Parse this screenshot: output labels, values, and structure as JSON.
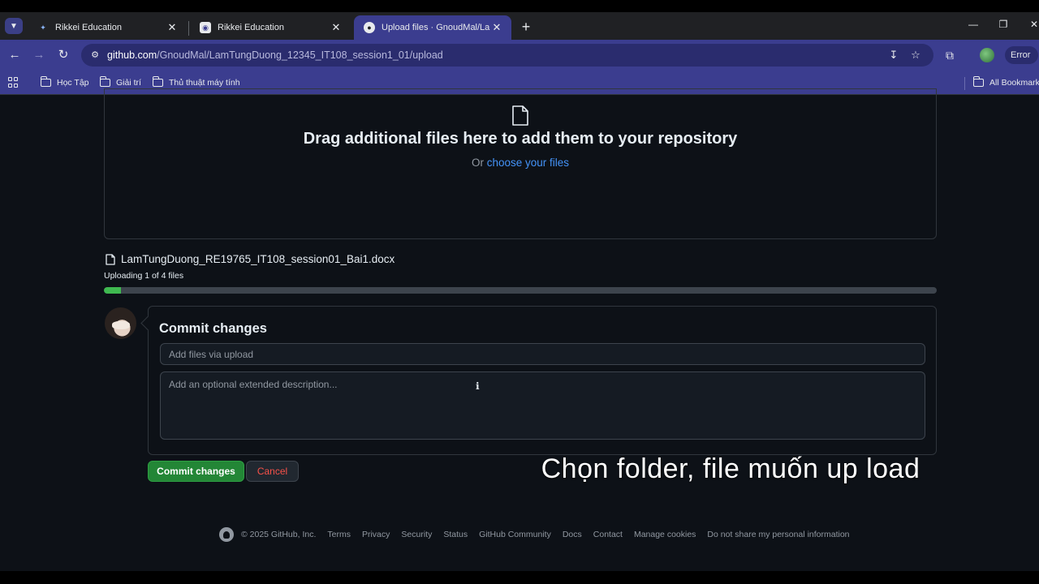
{
  "browser": {
    "tabs": [
      {
        "title": "Rikkei Education",
        "active": false
      },
      {
        "title": "Rikkei Education",
        "active": false
      },
      {
        "title": "Upload files · GnoudMal/LamTu",
        "active": true
      }
    ],
    "url_host": "github.com",
    "url_path": "/GnoudMal/LamTungDuong_12345_IT108_session1_01/upload",
    "profile_status": "Error",
    "bookmarks": [
      "Học Tập",
      "Giải trí",
      "Thủ thuật máy tính"
    ],
    "all_bookmarks": "All Bookmarks",
    "accent_color": "#3b3d8f"
  },
  "upload": {
    "dropzone_title": "Drag additional files here to add them to your repository",
    "dropzone_or": "Or",
    "dropzone_link": "choose your files",
    "file_name": "LamTungDuong_RE19765_IT108_session01_Bai1.docx",
    "status": "Uploading 1 of 4 files",
    "progress_fraction": 0.02
  },
  "commit": {
    "title": "Commit changes",
    "message_placeholder": "Add files via upload",
    "description_placeholder": "Add an optional extended description...",
    "commit_button": "Commit changes",
    "cancel_button": "Cancel"
  },
  "overlay_caption": "Chọn folder, file  muốn up load",
  "footer": {
    "copyright": "© 2025 GitHub, Inc.",
    "links": [
      "Terms",
      "Privacy",
      "Security",
      "Status",
      "GitHub Community",
      "Docs",
      "Contact",
      "Manage cookies",
      "Do not share my personal information"
    ]
  }
}
